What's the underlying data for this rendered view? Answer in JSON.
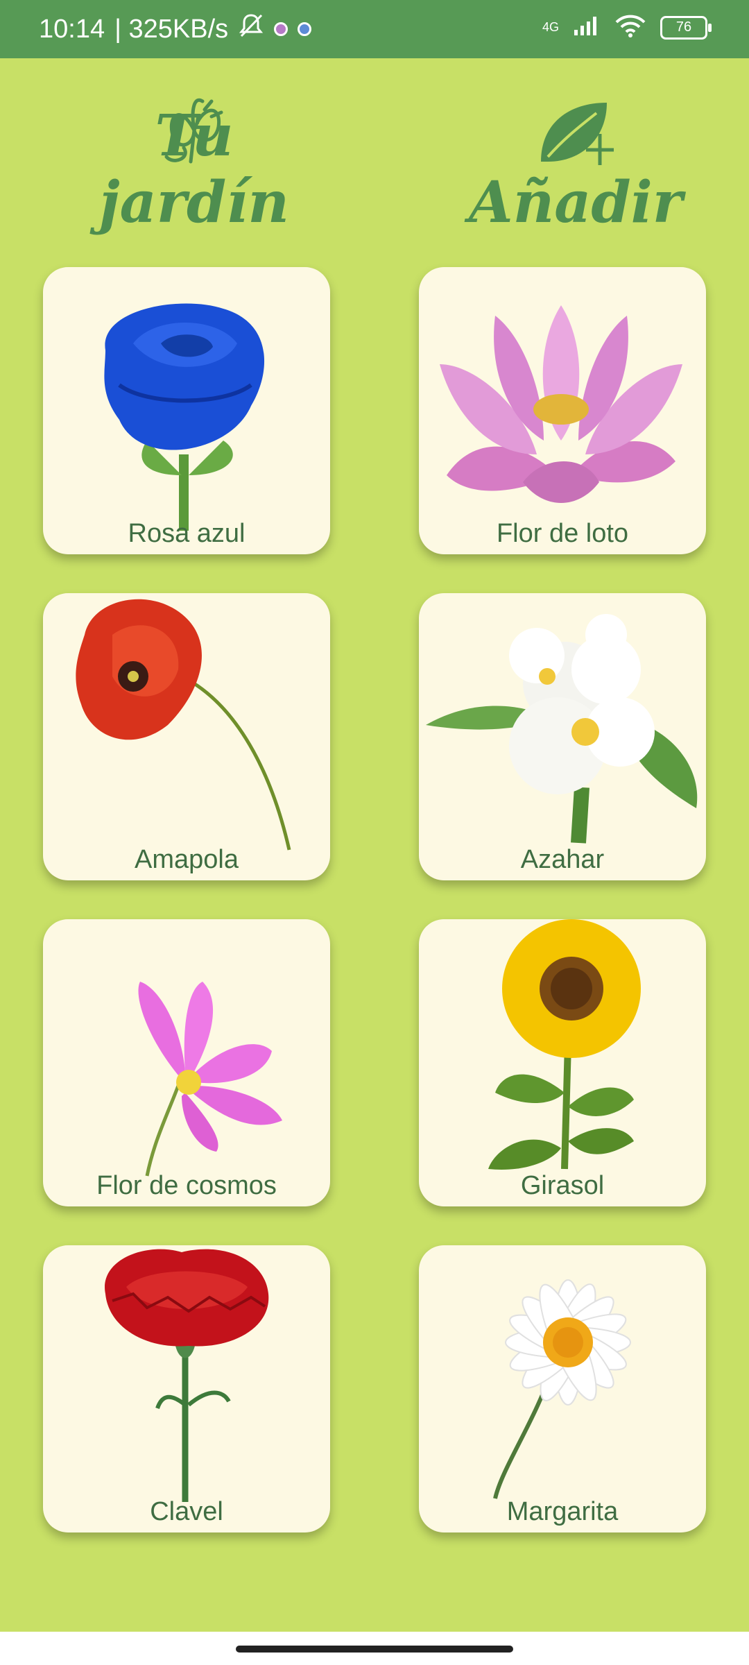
{
  "status_bar": {
    "time": "10:14",
    "speed": "| 325KB/s",
    "network": "4G",
    "battery": "76"
  },
  "header": {
    "garden_title": "Tu jardín",
    "add_title": "Añadir"
  },
  "flowers": [
    {
      "label": "Rosa azul"
    },
    {
      "label": "Flor de loto"
    },
    {
      "label": "Amapola"
    },
    {
      "label": "Azahar"
    },
    {
      "label": "Flor de cosmos"
    },
    {
      "label": "Girasol"
    },
    {
      "label": "Clavel"
    },
    {
      "label": "Margarita"
    }
  ],
  "colors": {
    "background": "#C8E066",
    "status_bar": "#579A55",
    "card": "#FDF9E3",
    "label_text": "#3F6D42",
    "logo_text": "#4E8E4F"
  }
}
